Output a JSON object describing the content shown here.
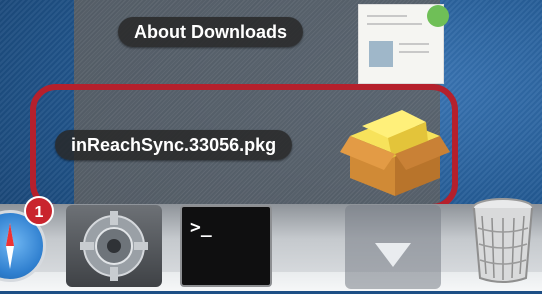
{
  "stack": {
    "items": [
      {
        "label": "About Downloads",
        "type": "document"
      },
      {
        "label": "inReachSync.33056.pkg",
        "type": "package"
      }
    ],
    "highlight_color": "#b5202c"
  },
  "dock": {
    "items": [
      {
        "name": "safari",
        "badge": "1"
      },
      {
        "name": "system-preferences"
      },
      {
        "name": "terminal",
        "prompt": ">_"
      },
      {
        "name": "downloads-stack-expand",
        "icon": "chevron-down-icon"
      },
      {
        "name": "trash"
      }
    ]
  }
}
